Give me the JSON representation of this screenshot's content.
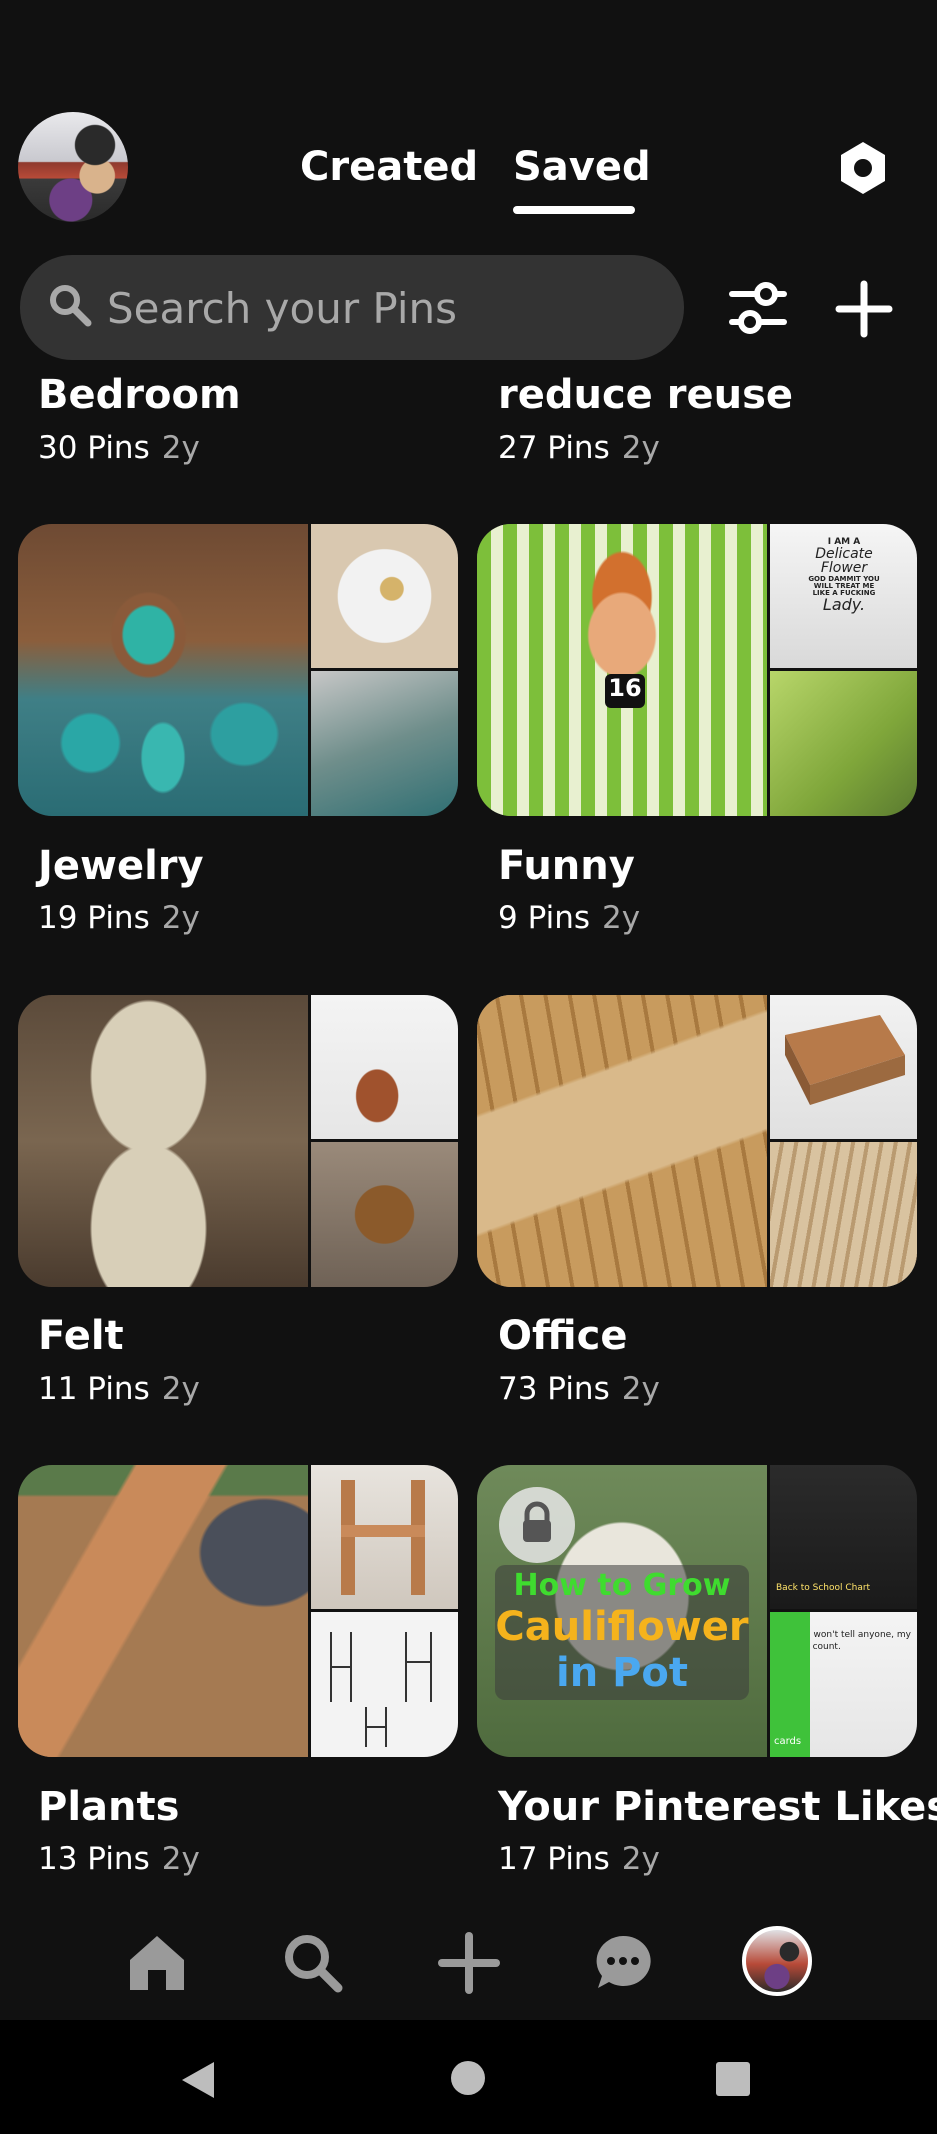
{
  "header": {
    "tabs": [
      {
        "label": "Created",
        "active": false
      },
      {
        "label": "Saved",
        "active": true
      }
    ]
  },
  "search": {
    "placeholder": "Search your Pins"
  },
  "boards": [
    {
      "title": "Bedroom",
      "pins": "30 Pins",
      "age": "2y"
    },
    {
      "title": "reduce reuse",
      "pins": "27 Pins",
      "age": "2y"
    },
    {
      "title": "Jewelry",
      "pins": "19 Pins",
      "age": "2y"
    },
    {
      "title": "Funny",
      "pins": "9 Pins",
      "age": "2y"
    },
    {
      "title": "Felt",
      "pins": "11 Pins",
      "age": "2y"
    },
    {
      "title": "Office",
      "pins": "73 Pins",
      "age": "2y"
    },
    {
      "title": "Plants",
      "pins": "13 Pins",
      "age": "2y"
    },
    {
      "title": "Your Pinterest Likes",
      "pins": "17 Pins",
      "age": "2y"
    }
  ],
  "cover_text": {
    "shirt": [
      "I AM A",
      "Delicate",
      "Flower",
      "GOD DAMMIT YOU",
      "WILL TREAT ME",
      "LIKE A FUCKING",
      "Lady."
    ],
    "mic": "16",
    "cauliflower": [
      "How to Grow",
      "Cauliflower",
      "in Pot"
    ],
    "back_to_school": "Back to School Chart",
    "comic": "en I say I won't tell anyone, my r doesn't count.",
    "cards": "cards"
  },
  "icons": {
    "settings": "hexagon-gear-icon",
    "search": "search-icon",
    "filter": "sliders-icon",
    "add": "plus-icon",
    "nav": [
      "home-icon",
      "search-icon",
      "plus-icon",
      "chat-icon",
      "profile-avatar"
    ]
  }
}
